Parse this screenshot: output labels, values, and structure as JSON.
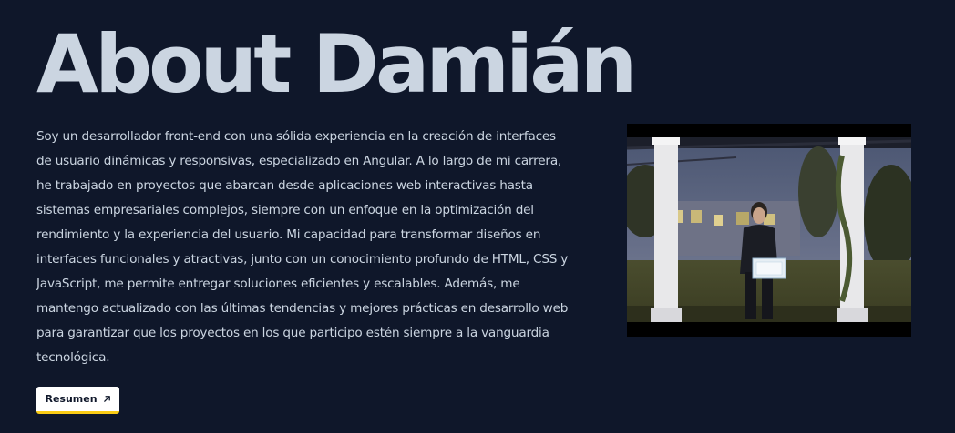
{
  "about": {
    "title": "About Damián",
    "bio": "Soy un desarrollador front-end con una sólida experiencia en la creación de interfaces de usuario dinámicas y responsivas, especializado en Angular. A lo largo de mi carrera, he trabajado en proyectos que abarcan desde aplicaciones web interactivas hasta sistemas empresariales complejos, siempre con un enfoque en la optimización del rendimiento y la experiencia del usuario. Mi capacidad para transformar diseños en interfaces funcionales y atractivas, junto con un conocimiento profundo de HTML, CSS y JavaScript, me permite entregar soluciones eficientes y escalables. Además, me mantengo actualizado con las últimas tendencias y mejores prácticas en desarrollo web para garantizar que los proyectos en los que participo estén siempre a la vanguardia tecnológica.",
    "resume_button": {
      "label": "Resumen",
      "icon": "arrow-up-right-icon"
    },
    "photo": {
      "description_icon": "profile-photo"
    }
  },
  "colors": {
    "background": "#0f172a",
    "text": "#cbd5e1",
    "button_bg": "#ffffff",
    "button_accent": "#facc15"
  }
}
